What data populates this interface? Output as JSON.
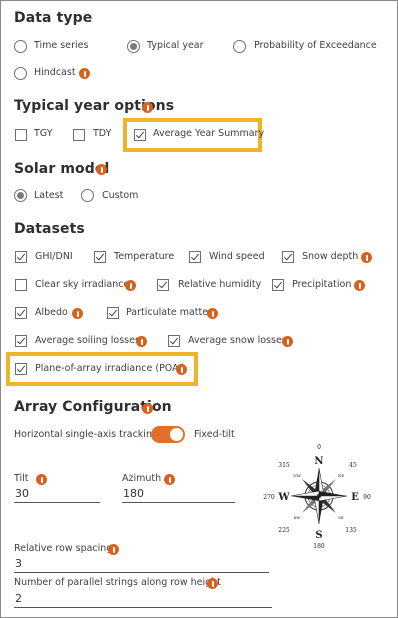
{
  "data_type": {
    "title": "Data type",
    "options": {
      "time_series": "Time series",
      "typical_year": "Typical year",
      "probability": "Probability of Exceedance",
      "hindcast": "Hindcast"
    },
    "selected": "Typical year"
  },
  "typical_year_options": {
    "title": "Typical year options",
    "tgy": "TGY",
    "tdy": "TDY",
    "avg_year_summary": "Average Year Summary",
    "checked": [
      "Average Year Summary"
    ]
  },
  "solar_model": {
    "title": "Solar model",
    "latest": "Latest",
    "custom": "Custom",
    "selected": "Latest"
  },
  "datasets": {
    "title": "Datasets",
    "ghi_dni": "GHI/DNI",
    "temperature": "Temperature",
    "wind_speed": "Wind speed",
    "snow_depth": "Snow depth",
    "clear_sky": "Clear sky irradiance",
    "relative_humidity": "Relative humidity",
    "precipitation": "Precipitation",
    "albedo": "Albedo",
    "particulate_matter": "Particulate matter",
    "avg_soiling": "Average soiling losses",
    "avg_snow": "Average snow losses",
    "poai": "Plane-of-array irradiance (POAI)"
  },
  "array_configuration": {
    "title": "Array Configuration",
    "tracking_left": "Horizontal single-axis tracking",
    "tracking_right": "Fixed-tilt",
    "tilt_label": "Tilt",
    "tilt_value": "30",
    "azimuth_label": "Azimuth",
    "azimuth_value": "180",
    "row_spacing_label": "Relative row spacing",
    "row_spacing_value": "3",
    "strings_label": "Number of parallel strings along row height",
    "strings_value": "2"
  },
  "compass": {
    "n": "N",
    "e": "E",
    "s": "S",
    "w": "W",
    "nw": "NW",
    "ne": "NE",
    "sw": "SW",
    "se": "SE",
    "deg_0": "0",
    "deg_45": "45",
    "deg_90": "90",
    "deg_135": "135",
    "deg_180": "180",
    "deg_225": "225",
    "deg_270": "270",
    "deg_315": "315"
  },
  "colors": {
    "accent": "#e1702a",
    "info": "#d9601d",
    "highlight": "#f0b429"
  }
}
